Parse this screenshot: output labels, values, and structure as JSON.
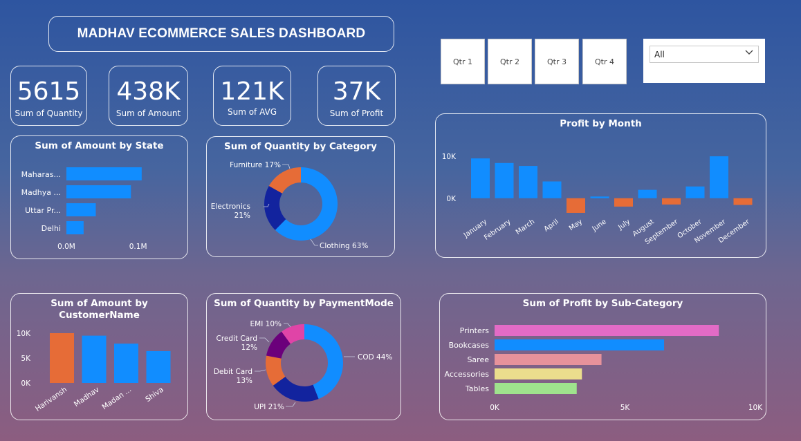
{
  "header": {
    "title": "MADHAV ECOMMERCE SALES DASHBOARD"
  },
  "kpis": [
    {
      "value": "5615",
      "label": "Sum of Quantity"
    },
    {
      "value": "438K",
      "label": "Sum of Amount"
    },
    {
      "value": "121K",
      "label": "Sum of AVG"
    },
    {
      "value": "37K",
      "label": "Sum of Profit"
    }
  ],
  "slicer": {
    "quarters": [
      "Qtr 1",
      "Qtr 2",
      "Qtr 3",
      "Qtr 4"
    ],
    "dropdown_value": "All",
    "dropdown_icon": "chevron-down-icon"
  },
  "colors": {
    "bar_blue": "#118dff",
    "bar_orange": "#e66c37",
    "donut_dark_blue": "#12239e",
    "donut_purple": "#6b007b",
    "donut_pink": "#e044a7",
    "printers": "#e26bc6",
    "bookcases": "#118dff",
    "saree": "#e6929b",
    "accessories": "#ebdd8d",
    "tables": "#9fe38d"
  },
  "chart_data": [
    {
      "id": "state",
      "type": "bar",
      "orientation": "horizontal",
      "title": "Sum of Amount by State",
      "categories": [
        "Maharas...",
        "Madhya ...",
        "Uttar Pr...",
        "Delhi"
      ],
      "values": [
        0.105,
        0.09,
        0.041,
        0.024
      ],
      "x_ticks": [
        "0.0M",
        "0.1M"
      ],
      "xlim": [
        0,
        0.11
      ]
    },
    {
      "id": "category",
      "type": "pie",
      "donut": true,
      "title": "Sum of Quantity by Category",
      "slices": [
        {
          "label": "Clothing 63%",
          "value": 63,
          "color": "#118dff"
        },
        {
          "label": "Electronics\n21%",
          "value": 21,
          "color": "#12239e"
        },
        {
          "label": "Furniture 17%",
          "value": 17,
          "color": "#e66c37"
        }
      ]
    },
    {
      "id": "month",
      "type": "bar",
      "title": "Profit by Month",
      "categories": [
        "January",
        "February",
        "March",
        "April",
        "May",
        "June",
        "July",
        "August",
        "September",
        "October",
        "November",
        "December"
      ],
      "values": [
        9500,
        8400,
        7700,
        4000,
        -3500,
        400,
        -2000,
        2000,
        -1500,
        2800,
        10000,
        -1600
      ],
      "y_ticks": [
        "10K",
        "0K"
      ],
      "ylim": [
        -4000,
        12000
      ]
    },
    {
      "id": "customer",
      "type": "bar",
      "title": "Sum of Amount by CustomerName",
      "categories": [
        "Harivansh",
        "Madhav",
        "Madan ...",
        "Shiva"
      ],
      "values": [
        10000,
        9500,
        7900,
        6400
      ],
      "y_ticks": [
        "10K",
        "5K",
        "0K"
      ],
      "ylim": [
        0,
        10000
      ]
    },
    {
      "id": "payment",
      "type": "pie",
      "donut": true,
      "title": "Sum of Quantity by PaymentMode",
      "slices": [
        {
          "label": "COD 44%",
          "value": 44,
          "color": "#118dff"
        },
        {
          "label": "UPI 21%",
          "value": 21,
          "color": "#12239e"
        },
        {
          "label": "Debit Card\n13%",
          "value": 13,
          "color": "#e66c37"
        },
        {
          "label": "Credit Card\n12%",
          "value": 12,
          "color": "#6b007b"
        },
        {
          "label": "EMI 10%",
          "value": 10,
          "color": "#e044a7"
        }
      ]
    },
    {
      "id": "subcategory",
      "type": "bar",
      "orientation": "horizontal",
      "title": "Sum of Profit by Sub-Category",
      "categories": [
        "Printers",
        "Bookcases",
        "Saree",
        "Accessories",
        "Tables"
      ],
      "values": [
        8600,
        6500,
        4100,
        3350,
        3150
      ],
      "x_ticks": [
        "0K",
        "5K",
        "10K"
      ],
      "xlim": [
        0,
        10000
      ]
    }
  ]
}
